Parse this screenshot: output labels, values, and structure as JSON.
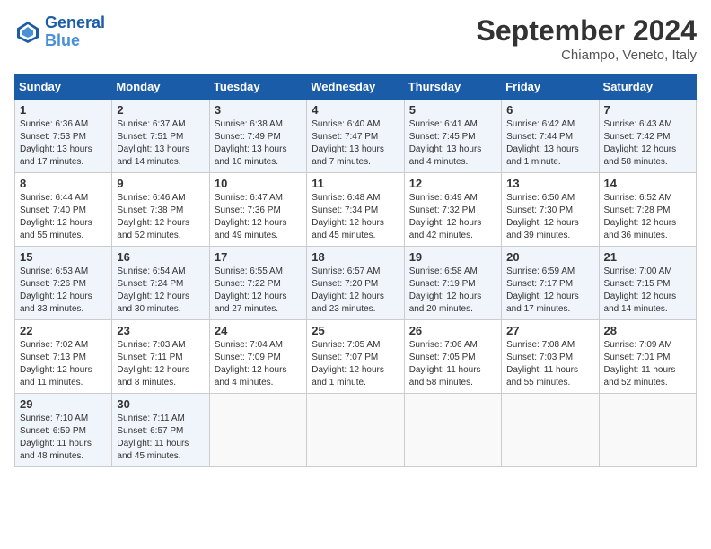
{
  "header": {
    "logo_line1": "General",
    "logo_line2": "Blue",
    "month_year": "September 2024",
    "location": "Chiampo, Veneto, Italy"
  },
  "days_of_week": [
    "Sunday",
    "Monday",
    "Tuesday",
    "Wednesday",
    "Thursday",
    "Friday",
    "Saturday"
  ],
  "weeks": [
    [
      {
        "day": "1",
        "sunrise": "Sunrise: 6:36 AM",
        "sunset": "Sunset: 7:53 PM",
        "daylight": "Daylight: 13 hours and 17 minutes."
      },
      {
        "day": "2",
        "sunrise": "Sunrise: 6:37 AM",
        "sunset": "Sunset: 7:51 PM",
        "daylight": "Daylight: 13 hours and 14 minutes."
      },
      {
        "day": "3",
        "sunrise": "Sunrise: 6:38 AM",
        "sunset": "Sunset: 7:49 PM",
        "daylight": "Daylight: 13 hours and 10 minutes."
      },
      {
        "day": "4",
        "sunrise": "Sunrise: 6:40 AM",
        "sunset": "Sunset: 7:47 PM",
        "daylight": "Daylight: 13 hours and 7 minutes."
      },
      {
        "day": "5",
        "sunrise": "Sunrise: 6:41 AM",
        "sunset": "Sunset: 7:45 PM",
        "daylight": "Daylight: 13 hours and 4 minutes."
      },
      {
        "day": "6",
        "sunrise": "Sunrise: 6:42 AM",
        "sunset": "Sunset: 7:44 PM",
        "daylight": "Daylight: 13 hours and 1 minute."
      },
      {
        "day": "7",
        "sunrise": "Sunrise: 6:43 AM",
        "sunset": "Sunset: 7:42 PM",
        "daylight": "Daylight: 12 hours and 58 minutes."
      }
    ],
    [
      {
        "day": "8",
        "sunrise": "Sunrise: 6:44 AM",
        "sunset": "Sunset: 7:40 PM",
        "daylight": "Daylight: 12 hours and 55 minutes."
      },
      {
        "day": "9",
        "sunrise": "Sunrise: 6:46 AM",
        "sunset": "Sunset: 7:38 PM",
        "daylight": "Daylight: 12 hours and 52 minutes."
      },
      {
        "day": "10",
        "sunrise": "Sunrise: 6:47 AM",
        "sunset": "Sunset: 7:36 PM",
        "daylight": "Daylight: 12 hours and 49 minutes."
      },
      {
        "day": "11",
        "sunrise": "Sunrise: 6:48 AM",
        "sunset": "Sunset: 7:34 PM",
        "daylight": "Daylight: 12 hours and 45 minutes."
      },
      {
        "day": "12",
        "sunrise": "Sunrise: 6:49 AM",
        "sunset": "Sunset: 7:32 PM",
        "daylight": "Daylight: 12 hours and 42 minutes."
      },
      {
        "day": "13",
        "sunrise": "Sunrise: 6:50 AM",
        "sunset": "Sunset: 7:30 PM",
        "daylight": "Daylight: 12 hours and 39 minutes."
      },
      {
        "day": "14",
        "sunrise": "Sunrise: 6:52 AM",
        "sunset": "Sunset: 7:28 PM",
        "daylight": "Daylight: 12 hours and 36 minutes."
      }
    ],
    [
      {
        "day": "15",
        "sunrise": "Sunrise: 6:53 AM",
        "sunset": "Sunset: 7:26 PM",
        "daylight": "Daylight: 12 hours and 33 minutes."
      },
      {
        "day": "16",
        "sunrise": "Sunrise: 6:54 AM",
        "sunset": "Sunset: 7:24 PM",
        "daylight": "Daylight: 12 hours and 30 minutes."
      },
      {
        "day": "17",
        "sunrise": "Sunrise: 6:55 AM",
        "sunset": "Sunset: 7:22 PM",
        "daylight": "Daylight: 12 hours and 27 minutes."
      },
      {
        "day": "18",
        "sunrise": "Sunrise: 6:57 AM",
        "sunset": "Sunset: 7:20 PM",
        "daylight": "Daylight: 12 hours and 23 minutes."
      },
      {
        "day": "19",
        "sunrise": "Sunrise: 6:58 AM",
        "sunset": "Sunset: 7:19 PM",
        "daylight": "Daylight: 12 hours and 20 minutes."
      },
      {
        "day": "20",
        "sunrise": "Sunrise: 6:59 AM",
        "sunset": "Sunset: 7:17 PM",
        "daylight": "Daylight: 12 hours and 17 minutes."
      },
      {
        "day": "21",
        "sunrise": "Sunrise: 7:00 AM",
        "sunset": "Sunset: 7:15 PM",
        "daylight": "Daylight: 12 hours and 14 minutes."
      }
    ],
    [
      {
        "day": "22",
        "sunrise": "Sunrise: 7:02 AM",
        "sunset": "Sunset: 7:13 PM",
        "daylight": "Daylight: 12 hours and 11 minutes."
      },
      {
        "day": "23",
        "sunrise": "Sunrise: 7:03 AM",
        "sunset": "Sunset: 7:11 PM",
        "daylight": "Daylight: 12 hours and 8 minutes."
      },
      {
        "day": "24",
        "sunrise": "Sunrise: 7:04 AM",
        "sunset": "Sunset: 7:09 PM",
        "daylight": "Daylight: 12 hours and 4 minutes."
      },
      {
        "day": "25",
        "sunrise": "Sunrise: 7:05 AM",
        "sunset": "Sunset: 7:07 PM",
        "daylight": "Daylight: 12 hours and 1 minute."
      },
      {
        "day": "26",
        "sunrise": "Sunrise: 7:06 AM",
        "sunset": "Sunset: 7:05 PM",
        "daylight": "Daylight: 11 hours and 58 minutes."
      },
      {
        "day": "27",
        "sunrise": "Sunrise: 7:08 AM",
        "sunset": "Sunset: 7:03 PM",
        "daylight": "Daylight: 11 hours and 55 minutes."
      },
      {
        "day": "28",
        "sunrise": "Sunrise: 7:09 AM",
        "sunset": "Sunset: 7:01 PM",
        "daylight": "Daylight: 11 hours and 52 minutes."
      }
    ],
    [
      {
        "day": "29",
        "sunrise": "Sunrise: 7:10 AM",
        "sunset": "Sunset: 6:59 PM",
        "daylight": "Daylight: 11 hours and 48 minutes."
      },
      {
        "day": "30",
        "sunrise": "Sunrise: 7:11 AM",
        "sunset": "Sunset: 6:57 PM",
        "daylight": "Daylight: 11 hours and 45 minutes."
      },
      null,
      null,
      null,
      null,
      null
    ]
  ]
}
